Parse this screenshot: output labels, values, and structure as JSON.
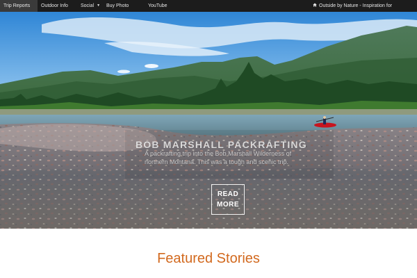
{
  "nav": {
    "items": [
      {
        "label": "Trip Reports",
        "active": true
      },
      {
        "label": "Outdoor Info"
      },
      {
        "label": "Social",
        "has_dropdown": true
      },
      {
        "label": "Buy Photo"
      },
      {
        "label": "YouTube"
      }
    ],
    "tagline": "Outside by Nature - Inspiration for",
    "caret": "▼"
  },
  "hero": {
    "title": "BOB MARSHALL PACKRAFTING",
    "text": "A packrafting trip into the Bob Marshall Wilderness of northern Montana. This was a tough and scenic trip.",
    "button_label": "READ MORE"
  },
  "section": {
    "title": "Featured Stories"
  },
  "colors": {
    "nav_bg": "#1c1c1c",
    "accent": "#d2691e"
  },
  "icons": {
    "home": "home-icon",
    "dropdown": "caret-down-icon"
  }
}
